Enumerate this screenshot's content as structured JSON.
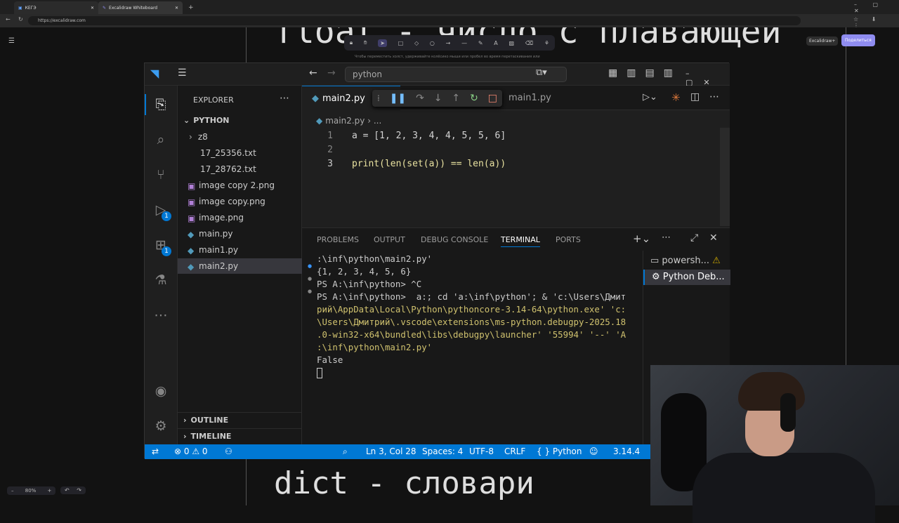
{
  "browser": {
    "tabs": [
      "КЕГЭ",
      "Excalidraw Whiteboard"
    ],
    "url": "https://excalidraw.com"
  },
  "whiteboard": {
    "top_text": "float - число с плавающей",
    "bottom_text": "dict - словари",
    "hint": "Чтобы переместить холст, удерживайте колёсико мыши или пробел во время перетаскивания или",
    "share_label": "Поделиться",
    "plus_label": "Excalidraw+",
    "zoom": "80%"
  },
  "vscode": {
    "search": "python",
    "explorer_title": "EXPLORER",
    "folder": "PYTHON",
    "files": [
      {
        "name": "z8",
        "type": "folder"
      },
      {
        "name": "17_25356.txt",
        "type": "txt"
      },
      {
        "name": "17_28762.txt",
        "type": "txt"
      },
      {
        "name": "image copy 2.png",
        "type": "png"
      },
      {
        "name": "image copy.png",
        "type": "png"
      },
      {
        "name": "image.png",
        "type": "png"
      },
      {
        "name": "main.py",
        "type": "py"
      },
      {
        "name": "main1.py",
        "type": "py"
      },
      {
        "name": "main2.py",
        "type": "py"
      }
    ],
    "outline": "OUTLINE",
    "timeline": "TIMELINE",
    "badges": {
      "debug": "1",
      "extensions": "1"
    },
    "tabs": {
      "active": "main2.py",
      "other": "main1.py"
    },
    "breadcrumb": {
      "file": "main2.py",
      "rest": "..."
    },
    "code": [
      {
        "n": "1",
        "text": "a = [1, 2, 3, 4, 4, 5, 5, 6]"
      },
      {
        "n": "2",
        "text": ""
      },
      {
        "n": "3",
        "text": "print(len(set(a)) == len(a))"
      }
    ],
    "panel_tabs": [
      "PROBLEMS",
      "OUTPUT",
      "DEBUG CONSOLE",
      "TERMINAL",
      "PORTS"
    ],
    "active_panel_tab": "TERMINAL",
    "terminal_lines": [
      ":\\inf\\python\\main2.py'",
      "{1, 2, 3, 4, 5, 6}",
      "PS A:\\inf\\python> ^C",
      "PS A:\\inf\\python>  a:; cd 'a:\\inf\\python'; & 'c:\\Users\\Дмит",
      "рий\\AppData\\Local\\Python\\pythoncore-3.14-64\\python.exe' 'c:",
      "\\Users\\Дмитрий\\.vscode\\extensions\\ms-python.debugpy-2025.18",
      ".0-win32-x64\\bundled\\libs\\debugpy\\launcher' '55994' '--' 'A",
      ":\\inf\\python\\main2.py'",
      "False"
    ],
    "terminal_list": [
      "powersh...",
      "Python Deb..."
    ],
    "status": {
      "errors": "0",
      "warnings": "0",
      "position": "Ln 3, Col 28",
      "spaces": "Spaces: 4",
      "encoding": "UTF-8",
      "eol": "CRLF",
      "language": "Python",
      "version": "3.14.4"
    },
    "colors": {
      "accent": "#0078d4",
      "status_bar": "#0078d4"
    }
  }
}
